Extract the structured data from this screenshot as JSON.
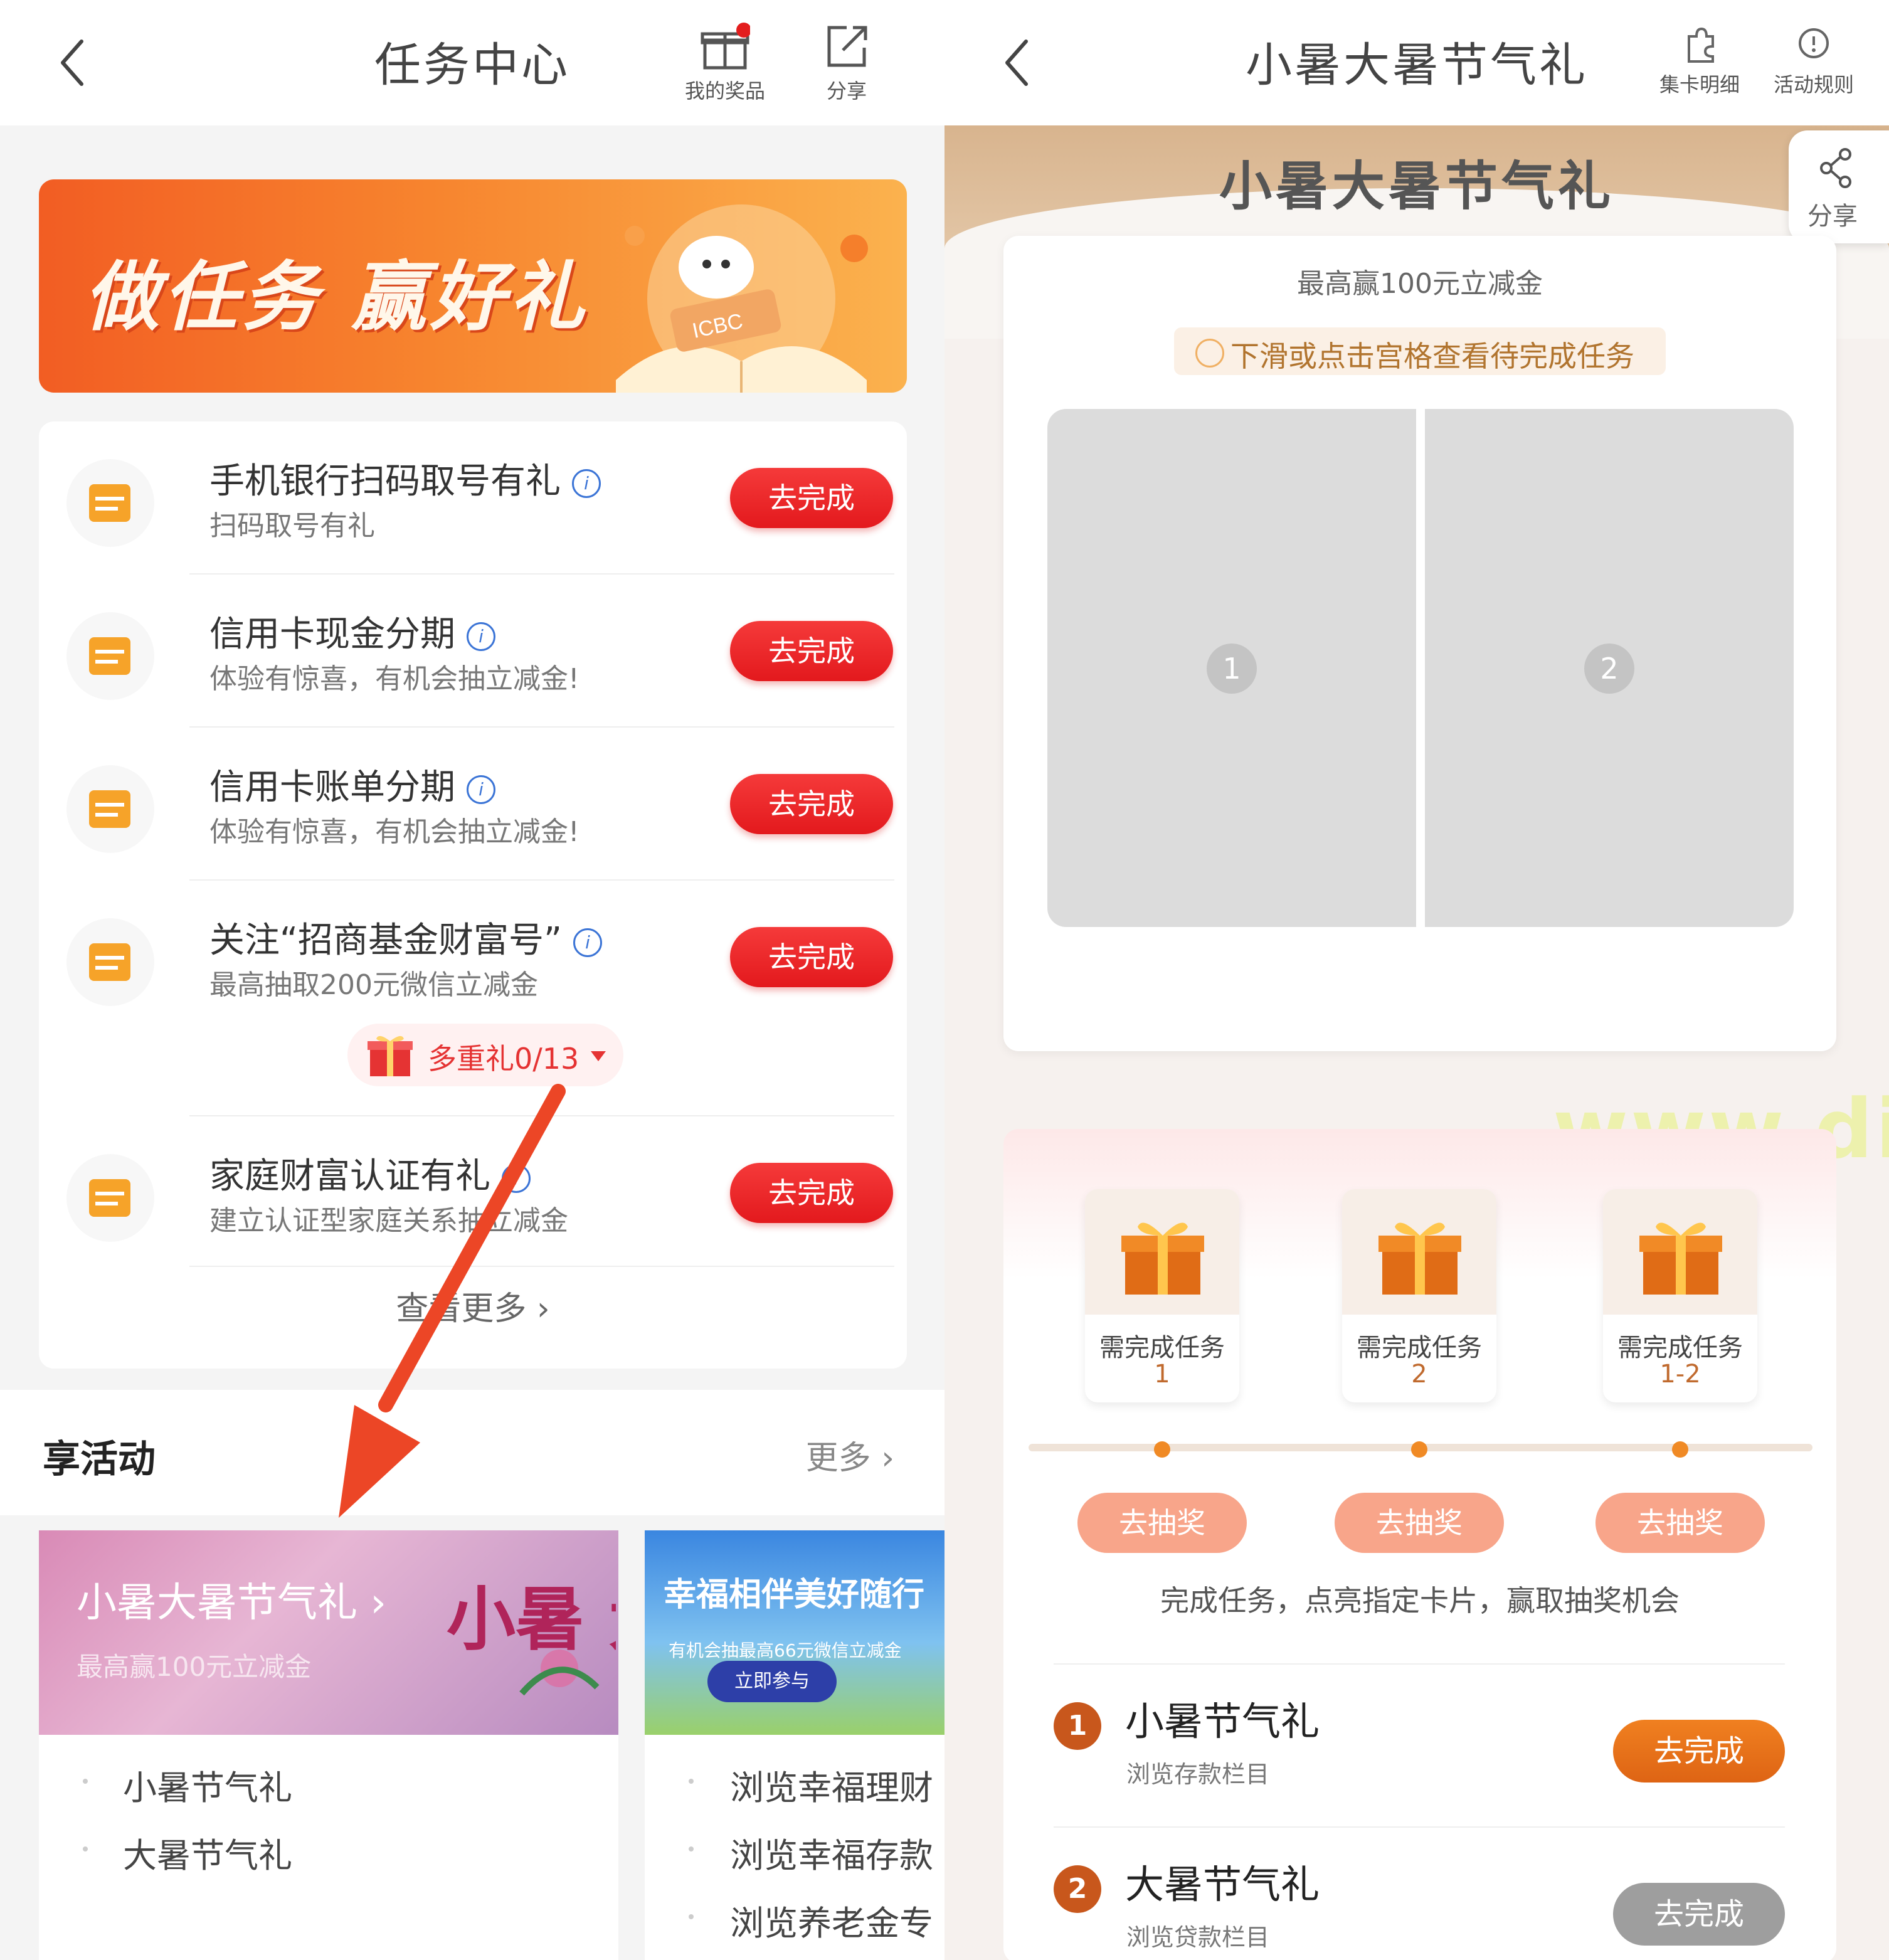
{
  "left": {
    "header": {
      "title": "任务中心",
      "prizes_label": "我的奖品",
      "share_label": "分享"
    },
    "banner": {
      "text": "做任务 赢好礼",
      "logo_text": "ICBC"
    },
    "tasks": [
      {
        "title": "手机银行扫码取号有礼",
        "subtitle": "扫码取号有礼",
        "button": "去完成"
      },
      {
        "title": "信用卡现金分期",
        "subtitle": "体验有惊喜，有机会抽立减金!",
        "button": "去完成"
      },
      {
        "title": "信用卡账单分期",
        "subtitle": "体验有惊喜，有机会抽立减金!",
        "button": "去完成"
      },
      {
        "title": "关注“招商基金财富号”",
        "subtitle": "最高抽取200元微信立减金",
        "button": "去完成"
      },
      {
        "title": "家庭财富认证有礼",
        "subtitle": "建立认证型家庭关系抽立减金",
        "button": "去完成"
      }
    ],
    "multi_gift": "多重礼0/13",
    "view_more": "查看更多 ›",
    "enjoy": {
      "title": "享活动",
      "more": "更多 ›"
    },
    "activity1": {
      "title": "小暑大暑节气礼 ›",
      "subtitle": "最高赢100元立减金",
      "calligraphy": "小暑 大暑",
      "items": [
        "小暑节气礼",
        "大暑节气礼"
      ]
    },
    "activity2": {
      "title": "幸福相伴美好随行",
      "subtitle": "有机会抽最高66元微信立减金",
      "button": "立即参与",
      "items": [
        "浏览幸福理财",
        "浏览幸福存款",
        "浏览养老金专"
      ]
    }
  },
  "right": {
    "header": {
      "title": "小暑大暑节气礼",
      "cards_label": "集卡明细",
      "rules_label": "活动规则"
    },
    "hero_title": "小暑大暑节气礼",
    "share_label": "分享",
    "subtitle": "最高赢100元立减金",
    "hint": "下滑或点击宫格查看待完成任务",
    "grid": [
      "1",
      "2"
    ],
    "prizes": [
      {
        "label": "需完成任务",
        "level": "1",
        "button": "去抽奖"
      },
      {
        "label": "需完成任务",
        "level": "2",
        "button": "去抽奖"
      },
      {
        "label": "需完成任务",
        "level": "1-2",
        "button": "去抽奖"
      }
    ],
    "tip": "完成任务，点亮指定卡片，赢取抽奖机会",
    "tasks": [
      {
        "num": "1",
        "title": "小暑节气礼",
        "subtitle": "浏览存款栏目",
        "button": "去完成",
        "state": "active"
      },
      {
        "num": "2",
        "title": "大暑节气礼",
        "subtitle": "浏览贷款栏目",
        "button": "去完成",
        "state": "disabled"
      }
    ]
  },
  "watermark": "www.diqile.com",
  "colors": {
    "primary_red": "#e3191d",
    "accent_orange": "#de6414",
    "calendar_icon": "#f6a329"
  }
}
